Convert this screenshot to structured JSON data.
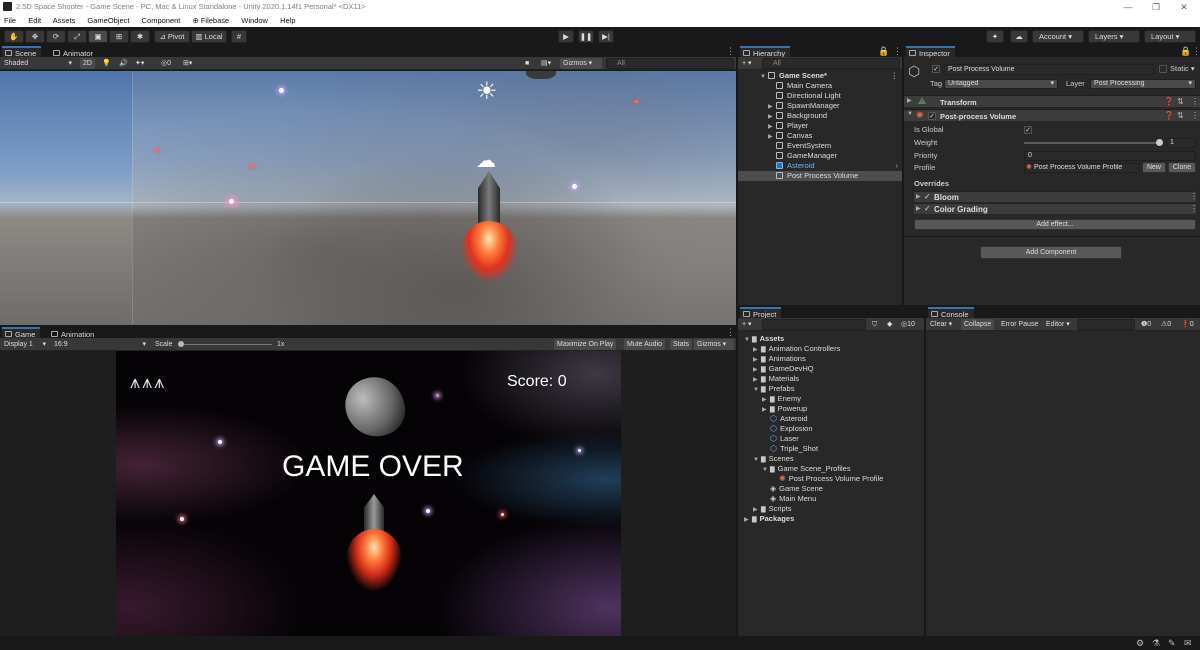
{
  "window": {
    "title": "2.5D Space Shooter - Game Scene - PC, Mac & Linux Standalone - Unity 2020.1.14f1 Personal* <DX11>",
    "minimize": "—",
    "maximize": "❐",
    "close": "✕"
  },
  "menu": [
    "File",
    "Edit",
    "Assets",
    "GameObject",
    "Component",
    "Filebase",
    "Window",
    "Help"
  ],
  "toolbar": {
    "pivot": "Pivot",
    "local": "Local",
    "account": "Account",
    "layers": "Layers",
    "layout": "Layout"
  },
  "scene_panel": {
    "tabs": [
      "Scene",
      "Animator"
    ],
    "shading": "Shaded",
    "mode_2d": "2D",
    "gizmos": "Gizmos",
    "search_placeholder": "All",
    "hidden_count": "0"
  },
  "game_panel": {
    "tabs": [
      "Game",
      "Animation"
    ],
    "display": "Display 1",
    "aspect": "16:9",
    "scale_label": "Scale",
    "scale_value": "1x",
    "maximize_on_play": "Maximize On Play",
    "mute_audio": "Mute Audio",
    "stats": "Stats",
    "gizmos": "Gizmos",
    "score": "Score: 0",
    "game_over": "GAME OVER",
    "lives": 3
  },
  "hierarchy": {
    "tab": "Hierarchy",
    "search_placeholder": "All",
    "scene": "Game Scene*",
    "items": [
      {
        "label": "Main Camera",
        "expandable": false
      },
      {
        "label": "Directional Light",
        "expandable": false
      },
      {
        "label": "SpawnManager",
        "expandable": true
      },
      {
        "label": "Background",
        "expandable": true
      },
      {
        "label": "Player",
        "expandable": true
      },
      {
        "label": "Canvas",
        "expandable": true
      },
      {
        "label": "EventSystem",
        "expandable": false
      },
      {
        "label": "GameManager",
        "expandable": false
      },
      {
        "label": "Asteroid",
        "expandable": false
      },
      {
        "label": "Post Process Volume",
        "expandable": false
      }
    ]
  },
  "inspector": {
    "tab": "Inspector",
    "object_name": "Post Process Volume",
    "static": "Static",
    "tag_label": "Tag",
    "tag_value": "Untagged",
    "layer_label": "Layer",
    "layer_value": "Post Processing",
    "transform": "Transform",
    "component": "Post-process Volume",
    "is_global_label": "Is Global",
    "weight_label": "Weight",
    "weight_value": "1",
    "priority_label": "Priority",
    "priority_value": "0",
    "profile_label": "Profile",
    "profile_value": "Post Process Volume Profile",
    "new": "New",
    "clone": "Clone",
    "overrides": "Overrides",
    "override_items": [
      "Bloom",
      "Color Grading"
    ],
    "add_effect": "Add effect...",
    "add_component": "Add Component"
  },
  "project": {
    "tab": "Project",
    "hidden_count": "10",
    "tree": [
      {
        "label": "Assets",
        "depth": 0,
        "type": "folder",
        "open": true,
        "bold": true
      },
      {
        "label": "Animation Controllers",
        "depth": 1,
        "type": "folder"
      },
      {
        "label": "Animations",
        "depth": 1,
        "type": "folder"
      },
      {
        "label": "GameDevHQ",
        "depth": 1,
        "type": "folder"
      },
      {
        "label": "Materials",
        "depth": 1,
        "type": "folder"
      },
      {
        "label": "Prefabs",
        "depth": 1,
        "type": "folder",
        "open": true
      },
      {
        "label": "Enemy",
        "depth": 2,
        "type": "folder"
      },
      {
        "label": "Powerup",
        "depth": 2,
        "type": "folder"
      },
      {
        "label": "Asteroid",
        "depth": 2,
        "type": "prefab"
      },
      {
        "label": "Explosion",
        "depth": 2,
        "type": "prefab"
      },
      {
        "label": "Laser",
        "depth": 2,
        "type": "prefab"
      },
      {
        "label": "Triple_Shot",
        "depth": 2,
        "type": "prefab"
      },
      {
        "label": "Scenes",
        "depth": 1,
        "type": "folder",
        "open": true
      },
      {
        "label": "Game Scene_Profiles",
        "depth": 2,
        "type": "folder",
        "open": true
      },
      {
        "label": "Post Process Volume Profile",
        "depth": 3,
        "type": "profile"
      },
      {
        "label": "Game Scene",
        "depth": 2,
        "type": "scene"
      },
      {
        "label": "Main Menu",
        "depth": 2,
        "type": "scene"
      },
      {
        "label": "Scripts",
        "depth": 1,
        "type": "folder"
      },
      {
        "label": "Packages",
        "depth": 0,
        "type": "folder",
        "bold": true
      }
    ]
  },
  "console": {
    "tab": "Console",
    "clear": "Clear",
    "collapse": "Collapse",
    "error_pause": "Error Pause",
    "editor": "Editor",
    "log_count": "0",
    "warning_count": "0",
    "error_count": "0"
  },
  "colors": {
    "accent": "#3a72b0",
    "selection": "#4d4d4d",
    "prefab_blue": "#6eb4ff"
  }
}
